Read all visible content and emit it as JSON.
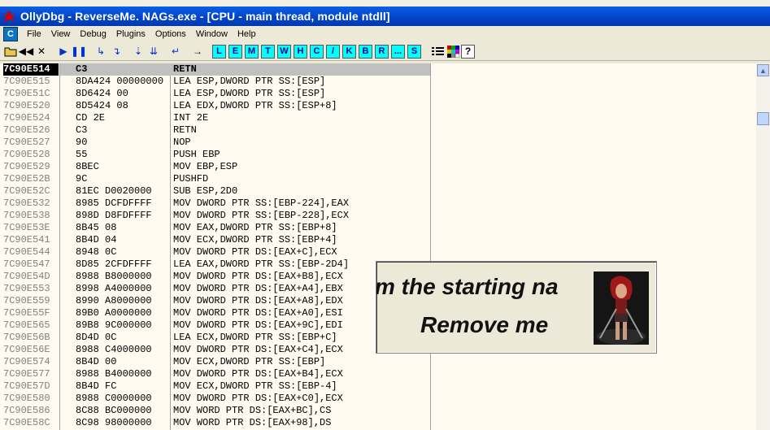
{
  "window": {
    "title": "OllyDbg - ReverseMe. NAGs.exe - [CPU - main thread, module ntdll]"
  },
  "menu": {
    "icon_label": "C",
    "items": [
      "File",
      "View",
      "Debug",
      "Plugins",
      "Options",
      "Window",
      "Help"
    ]
  },
  "toolbar": {
    "letter_buttons": [
      "L",
      "E",
      "M",
      "T",
      "W",
      "H",
      "C",
      "/",
      "K",
      "B",
      "R",
      "...",
      "S"
    ],
    "icons": [
      "open-icon",
      "restart-icon",
      "rewind-icon",
      "close-icon",
      "run-icon",
      "pause-icon",
      "step-into-icon",
      "step-over-icon",
      "trace-into-icon",
      "trace-over-icon",
      "execute-till-return-icon",
      "goto-icon",
      "list-icon",
      "color-grid-icon",
      "help-icon"
    ]
  },
  "disassembly": {
    "selected_index": 0,
    "rows": [
      {
        "addr": "7C90E514",
        "hex": "C3",
        "asm": "RETN"
      },
      {
        "addr": "7C90E515",
        "hex": "8DA424 00000000",
        "asm": "LEA ESP,DWORD PTR SS:[ESP]"
      },
      {
        "addr": "7C90E51C",
        "hex": "8D6424 00",
        "asm": "LEA ESP,DWORD PTR SS:[ESP]"
      },
      {
        "addr": "7C90E520",
        "hex": "8D5424 08",
        "asm": "LEA EDX,DWORD PTR SS:[ESP+8]"
      },
      {
        "addr": "7C90E524",
        "hex": "CD 2E",
        "asm": "INT 2E"
      },
      {
        "addr": "7C90E526",
        "hex": "C3",
        "asm": "RETN"
      },
      {
        "addr": "7C90E527",
        "hex": "90",
        "asm": "NOP"
      },
      {
        "addr": "7C90E528",
        "hex": "55",
        "asm": "PUSH EBP"
      },
      {
        "addr": "7C90E529",
        "hex": "8BEC",
        "asm": "MOV EBP,ESP"
      },
      {
        "addr": "7C90E52B",
        "hex": "9C",
        "asm": "PUSHFD"
      },
      {
        "addr": "7C90E52C",
        "hex": "81EC D0020000",
        "asm": "SUB ESP,2D0"
      },
      {
        "addr": "7C90E532",
        "hex": "8985 DCFDFFFF",
        "asm": "MOV DWORD PTR SS:[EBP-224],EAX"
      },
      {
        "addr": "7C90E538",
        "hex": "898D D8FDFFFF",
        "asm": "MOV DWORD PTR SS:[EBP-228],ECX"
      },
      {
        "addr": "7C90E53E",
        "hex": "8B45 08",
        "asm": "MOV EAX,DWORD PTR SS:[EBP+8]"
      },
      {
        "addr": "7C90E541",
        "hex": "8B4D 04",
        "asm": "MOV ECX,DWORD PTR SS:[EBP+4]"
      },
      {
        "addr": "7C90E544",
        "hex": "8948 0C",
        "asm": "MOV DWORD PTR DS:[EAX+C],ECX"
      },
      {
        "addr": "7C90E547",
        "hex": "8D85 2CFDFFFF",
        "asm": "LEA EAX,DWORD PTR SS:[EBP-2D4]"
      },
      {
        "addr": "7C90E54D",
        "hex": "8988 B8000000",
        "asm": "MOV DWORD PTR DS:[EAX+B8],ECX"
      },
      {
        "addr": "7C90E553",
        "hex": "8998 A4000000",
        "asm": "MOV DWORD PTR DS:[EAX+A4],EBX"
      },
      {
        "addr": "7C90E559",
        "hex": "8990 A8000000",
        "asm": "MOV DWORD PTR DS:[EAX+A8],EDX"
      },
      {
        "addr": "7C90E55F",
        "hex": "89B0 A0000000",
        "asm": "MOV DWORD PTR DS:[EAX+A0],ESI"
      },
      {
        "addr": "7C90E565",
        "hex": "89B8 9C000000",
        "asm": "MOV DWORD PTR DS:[EAX+9C],EDI"
      },
      {
        "addr": "7C90E56B",
        "hex": "8D4D 0C",
        "asm": "LEA ECX,DWORD PTR SS:[EBP+C]"
      },
      {
        "addr": "7C90E56E",
        "hex": "8988 C4000000",
        "asm": "MOV DWORD PTR DS:[EAX+C4],ECX"
      },
      {
        "addr": "7C90E574",
        "hex": "8B4D 00",
        "asm": "MOV ECX,DWORD PTR SS:[EBP]"
      },
      {
        "addr": "7C90E577",
        "hex": "8988 B4000000",
        "asm": "MOV DWORD PTR DS:[EAX+B4],ECX"
      },
      {
        "addr": "7C90E57D",
        "hex": "8B4D FC",
        "asm": "MOV ECX,DWORD PTR SS:[EBP-4]"
      },
      {
        "addr": "7C90E580",
        "hex": "8988 C0000000",
        "asm": "MOV DWORD PTR DS:[EAX+C0],ECX"
      },
      {
        "addr": "7C90E586",
        "hex": "8C88 BC000000",
        "asm": "MOV WORD PTR DS:[EAX+BC],CS"
      },
      {
        "addr": "7C90E58C",
        "hex": "8C98 98000000",
        "asm": "MOV WORD PTR DS:[EAX+98],DS"
      }
    ]
  },
  "nag": {
    "line1": "m the starting na",
    "line2": "Remove me"
  }
}
